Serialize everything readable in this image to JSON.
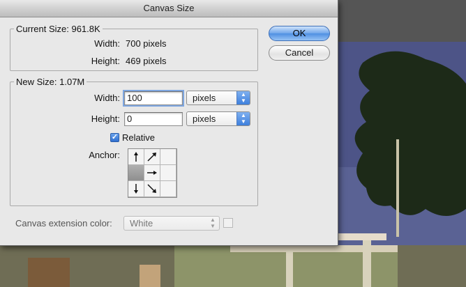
{
  "window": {
    "title": "Canvas Size"
  },
  "current_size": {
    "legend": "Current Size: 961.8K",
    "width_label": "Width:",
    "width_value": "700 pixels",
    "height_label": "Height:",
    "height_value": "469 pixels"
  },
  "new_size": {
    "legend": "New Size: 1.07M",
    "width_label": "Width:",
    "width_value": "100",
    "width_unit": "pixels",
    "height_label": "Height:",
    "height_value": "0",
    "height_unit": "pixels",
    "relative_label": "Relative",
    "relative_checked": true,
    "anchor_label": "Anchor:"
  },
  "extension": {
    "label": "Canvas extension color:",
    "value": "White"
  },
  "buttons": {
    "ok": "OK",
    "cancel": "Cancel"
  },
  "colors": {
    "accent": "#4f8fe2",
    "dialog_bg": "#e8e8e8"
  }
}
